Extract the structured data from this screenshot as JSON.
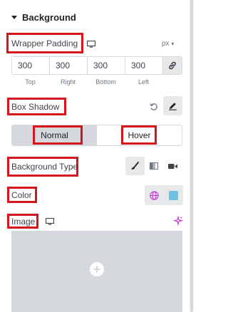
{
  "section": {
    "title": "Background"
  },
  "wrapper_padding": {
    "label": "Wrapper Padding",
    "unit": "px",
    "values": [
      "300",
      "300",
      "300",
      "300"
    ],
    "sides": [
      "Top",
      "Right",
      "Bottom",
      "Left"
    ]
  },
  "box_shadow": {
    "label": "Box Shadow"
  },
  "state_tabs": {
    "normal": "Normal",
    "hover": "Hover"
  },
  "background_type": {
    "label": "Background Type"
  },
  "color": {
    "label": "Color",
    "swatch": "#6ec1e4"
  },
  "image": {
    "label": "Image"
  },
  "colors": {
    "highlight": "#d6141b",
    "accent": "#c036d3"
  }
}
